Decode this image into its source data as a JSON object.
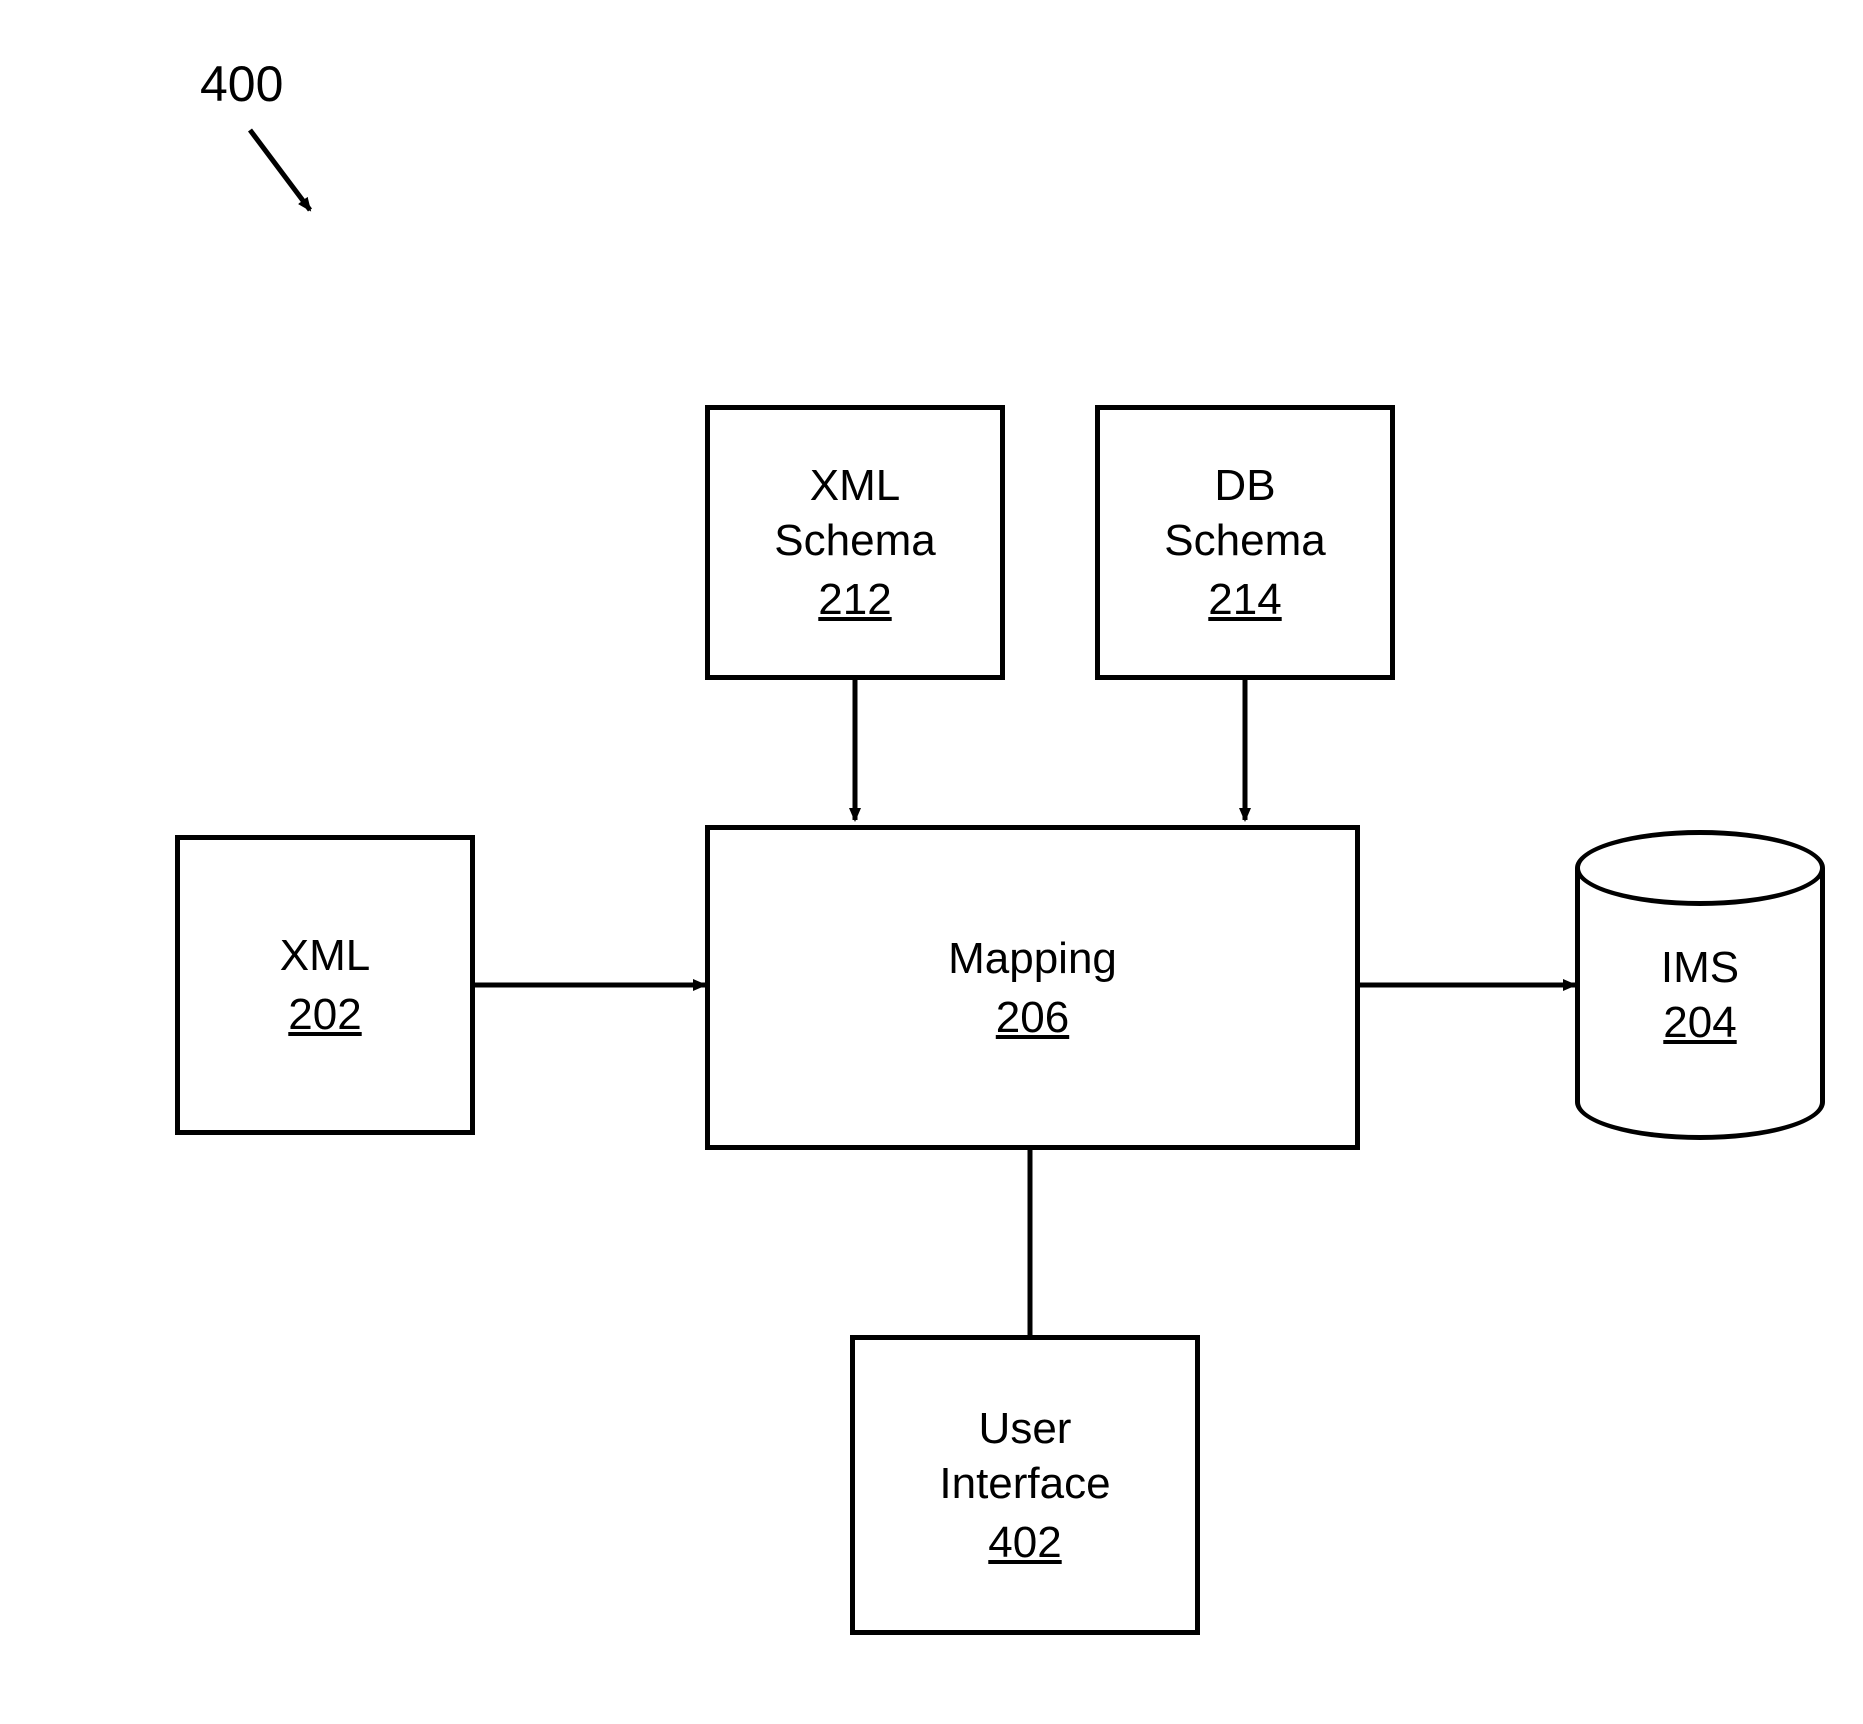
{
  "figure_ref": "400",
  "blocks": {
    "xml_schema": {
      "title": "XML\nSchema",
      "ref": "212"
    },
    "db_schema": {
      "title": "DB\nSchema",
      "ref": "214"
    },
    "xml": {
      "title": "XML",
      "ref": "202"
    },
    "mapping": {
      "title": "Mapping",
      "ref": "206"
    },
    "ims": {
      "title": "IMS",
      "ref": "204"
    },
    "ui": {
      "title": "User\nInterface",
      "ref": "402"
    }
  }
}
